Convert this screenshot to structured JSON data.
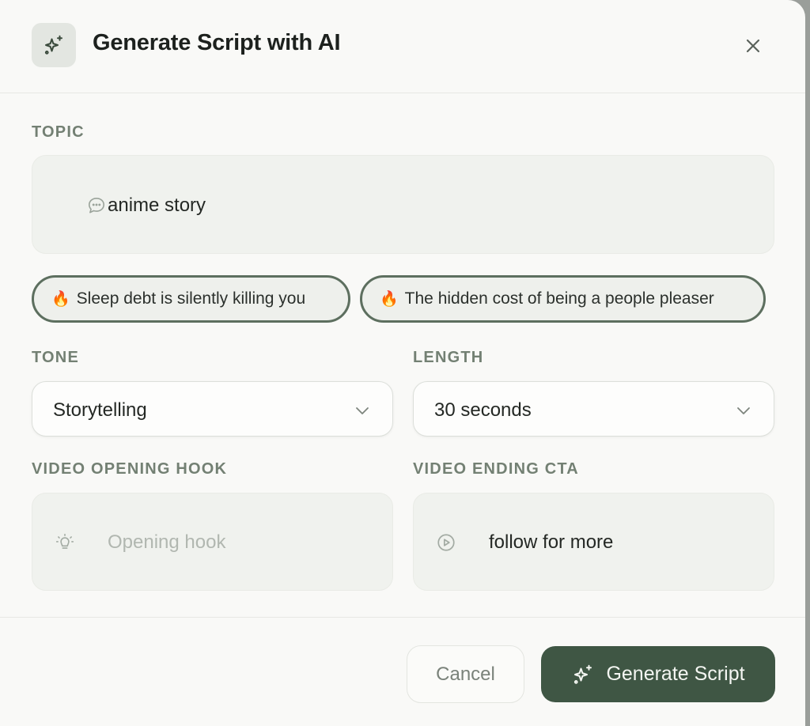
{
  "header": {
    "title": "Generate Script with AI",
    "icon": "sparkles-icon",
    "close_icon": "close-icon"
  },
  "topic": {
    "label": "TOPIC",
    "value": "anime story",
    "icon": "chat-bubble-icon"
  },
  "suggestions": [
    {
      "emoji": "🔥",
      "label": "Sleep debt is silently killing you"
    },
    {
      "emoji": "🔥",
      "label": "The hidden cost of being a people pleaser"
    }
  ],
  "tone": {
    "label": "TONE",
    "selected": "Storytelling"
  },
  "length": {
    "label": "LENGTH",
    "selected": "30 seconds"
  },
  "hook": {
    "label": "VIDEO OPENING HOOK",
    "value": "",
    "placeholder": "Opening hook",
    "icon": "lightbulb-icon"
  },
  "cta": {
    "label": "VIDEO ENDING CTA",
    "value": "follow for more",
    "icon": "play-circle-icon"
  },
  "footer": {
    "cancel_label": "Cancel",
    "generate_label": "Generate Script"
  },
  "colors": {
    "accent": "#3f5644",
    "chip_border": "#5d6f5f",
    "label": "#738073",
    "background": "#f9f9f7"
  }
}
